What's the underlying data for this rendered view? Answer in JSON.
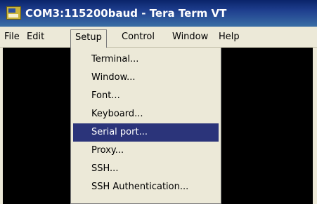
{
  "window": {
    "title": "COM3:115200baud - Tera Term VT",
    "icon": "tera-term-icon"
  },
  "menubar": {
    "items": [
      "File",
      "Edit",
      "Setup",
      "Control",
      "Window",
      "Help"
    ],
    "open_menu": "Setup"
  },
  "setup_menu": {
    "items": [
      "Terminal...",
      "Window...",
      "Font...",
      "Keyboard...",
      "Serial port...",
      "Proxy...",
      "SSH...",
      "SSH Authentication..."
    ],
    "highlighted": "Serial port..."
  },
  "colors": {
    "highlight": "#2b347a",
    "terminal_background": "#000000",
    "menu_background": "#ece9d8"
  }
}
